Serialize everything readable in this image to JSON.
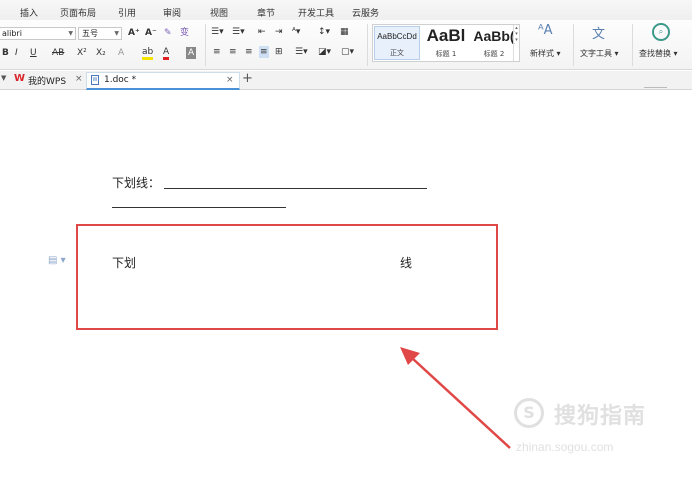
{
  "menu": {
    "tabs": [
      "插入",
      "页面布局",
      "引用",
      "审阅",
      "视图",
      "章节",
      "开发工具",
      "云服务"
    ]
  },
  "ribbon": {
    "font_name": "alibri",
    "font_size": "五号",
    "grow_font": "A⁺",
    "shrink_font": "A⁻",
    "clear_format": "✎",
    "phonetic": "变",
    "bold": "B",
    "italic": "I",
    "underline": "U",
    "strikethrough": "AB",
    "superscript": "X²",
    "subscript": "X₂",
    "text_effect": "A",
    "highlight": "ab",
    "font_color": "A",
    "char_shading": "A",
    "styles": [
      {
        "preview": "AaBbCcDd",
        "caption": "正文"
      },
      {
        "preview": "AaBl",
        "caption": "标题 1"
      },
      {
        "preview": "AaBb(",
        "caption": "标题 2"
      }
    ],
    "new_style": "新样式",
    "text_tools": "文字工具",
    "find_replace": "查找替换"
  },
  "tabs": {
    "my_wps": "我的WPS",
    "doc_name": "1.doc *",
    "close": "×",
    "add": "+"
  },
  "document": {
    "line1_label": "下划线：",
    "boxed_left": "下划",
    "boxed_right": "线"
  },
  "watermark": {
    "brand": "搜狗指南",
    "url": "zhinan.sogou.com"
  },
  "colors": {
    "accent": "#4a90d9",
    "annotation_red": "#e04848",
    "wps_red": "#d9262c"
  }
}
